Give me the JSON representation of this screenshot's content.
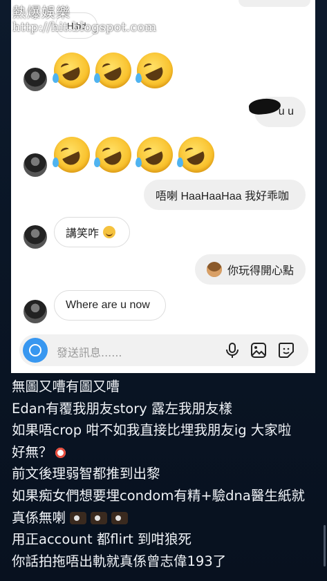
{
  "watermark": {
    "title": "熱爆娛樂",
    "url": "http://hit.blogspot.com"
  },
  "chat": {
    "overlay_text": "H.bd",
    "msg_uu": "u u",
    "msg_out_1": "唔喇 HaaHaaHaa 我好乖咖",
    "msg_in_1": "講笑咋",
    "msg_out_2": "你玩得開心點",
    "msg_in_2": "Where are u now",
    "emoji_row1": [
      "rolling-on-floor-laughing",
      "rolling-on-floor-laughing",
      "rolling-on-floor-laughing"
    ],
    "emoji_row2": [
      "rolling-on-floor-laughing",
      "rolling-on-floor-laughing",
      "rolling-on-floor-laughing",
      "rolling-on-floor-laughing"
    ]
  },
  "input": {
    "placeholder": "發送訊息......"
  },
  "caption": {
    "line1": "無圖又嘈有圖又嘈",
    "line2": "Edan有覆我朋友story 露左我朋友樣",
    "line3": "如果唔crop 咁不如我直接比埋我朋友ig 大家啦",
    "line4": "好無？",
    "line5": "前文後理弱智都推到出黎",
    "line6": "如果痴女們想要埋condom有精+驗dna醫生紙就",
    "line7": "真係無喇",
    "line8": "用正account 都flirt 到咁狼死",
    "line9": "你話拍拖唔出軌就真係曾志偉193了"
  },
  "colors": {
    "accent": "#3897f0",
    "background": "#0b1626",
    "panel": "#ffffff"
  }
}
